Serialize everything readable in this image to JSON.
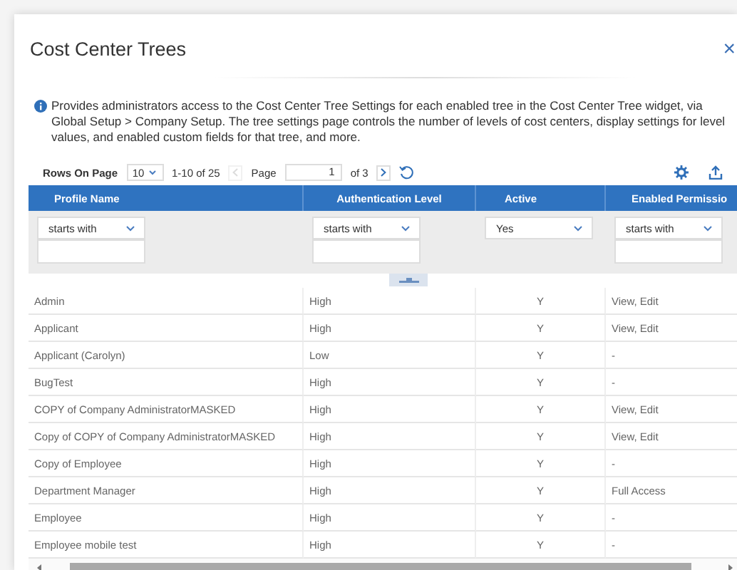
{
  "dialog": {
    "title": "Cost Center Trees",
    "close": "×"
  },
  "info": "Provides administrators access to the Cost Center Tree Settings for each enabled tree in the Cost Center Tree widget, via Global Setup > Company Setup. The tree settings page controls the number of levels of cost centers, display settings for level values, and enabled custom fields for that tree, and more.",
  "toolbar": {
    "rows_label": "Rows On Page",
    "rows_value": "10",
    "range": "1-10 of 25",
    "prev_disabled": true,
    "page_label": "Page",
    "page_value": "1",
    "page_total": "of 3",
    "next_disabled": false
  },
  "table": {
    "columns": [
      {
        "label": "Profile Name",
        "filter": {
          "kind": "select-input",
          "value": "starts with"
        }
      },
      {
        "label": "Authentication Level",
        "filter": {
          "kind": "select-input",
          "value": "starts with"
        }
      },
      {
        "label": "Active",
        "filter": {
          "kind": "select",
          "value": "Yes"
        }
      },
      {
        "label": "Enabled Permissio",
        "filter": {
          "kind": "select-input",
          "value": "starts with"
        }
      }
    ],
    "rows": [
      [
        "Admin",
        "High",
        "Y",
        "View, Edit"
      ],
      [
        "Applicant",
        "High",
        "Y",
        "View, Edit"
      ],
      [
        "Applicant (Carolyn)",
        "Low",
        "Y",
        "-"
      ],
      [
        "BugTest",
        "High",
        "Y",
        "-"
      ],
      [
        "COPY of Company AdministratorMASKED",
        "High",
        "Y",
        "View, Edit"
      ],
      [
        "Copy of COPY of Company AdministratorMASKED",
        "High",
        "Y",
        "View, Edit"
      ],
      [
        "Copy of Employee",
        "High",
        "Y",
        "-"
      ],
      [
        "Department Manager",
        "High",
        "Y",
        "Full Access"
      ],
      [
        "Employee",
        "High",
        "Y",
        "-"
      ],
      [
        "Employee mobile test",
        "High",
        "Y",
        "-"
      ]
    ]
  }
}
